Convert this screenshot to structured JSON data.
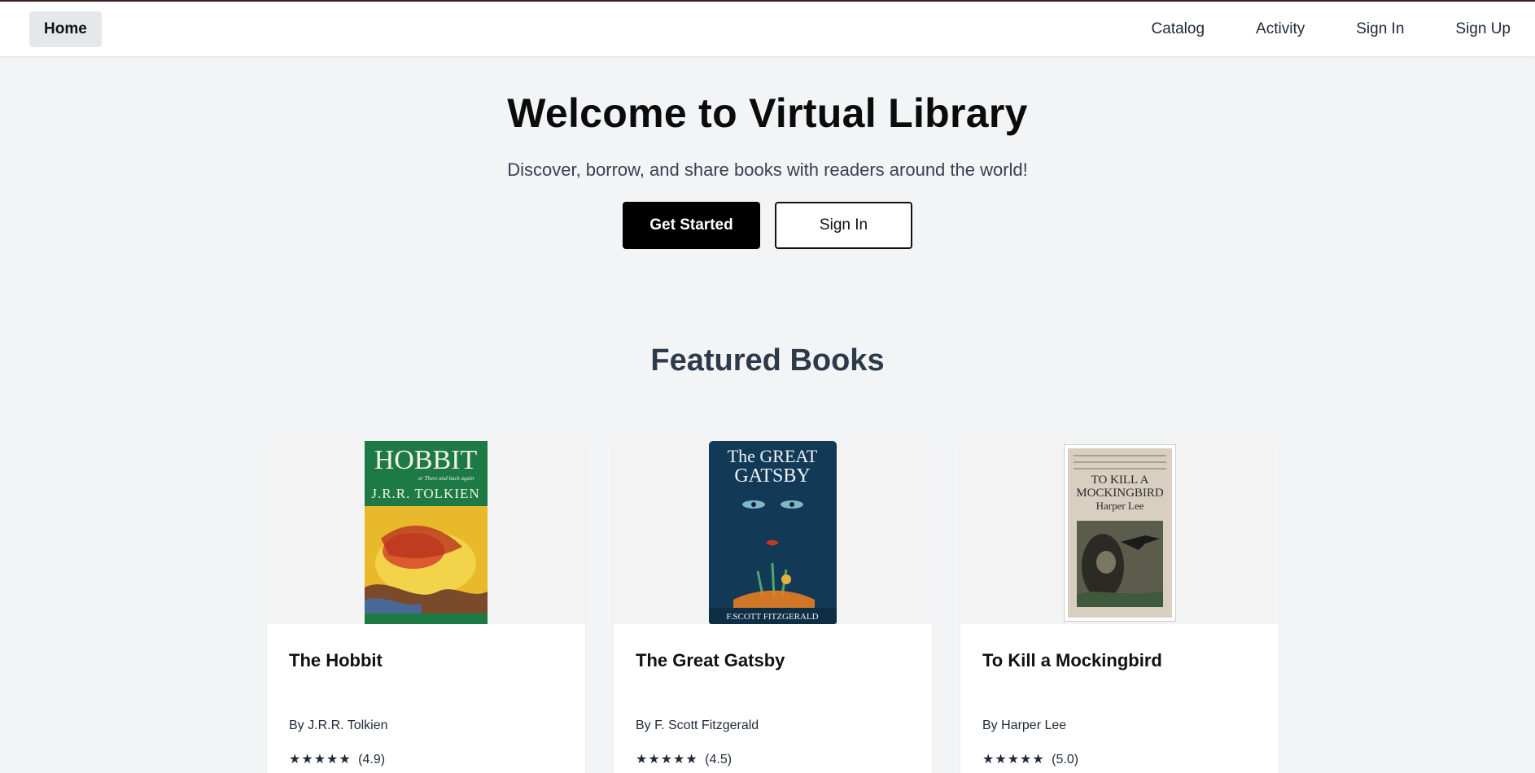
{
  "nav": {
    "home": "Home",
    "links": [
      "Catalog",
      "Activity",
      "Sign In",
      "Sign Up"
    ]
  },
  "hero": {
    "title": "Welcome to Virtual Library",
    "subtitle": "Discover, borrow, and share books with readers around the world!",
    "primary_button": "Get Started",
    "secondary_button": "Sign In"
  },
  "featured": {
    "title": "Featured Books",
    "books": [
      {
        "title": "The Hobbit",
        "author": "By J.R.R. Tolkien",
        "stars": "★★★★★",
        "rating": "(4.9)",
        "cover": {
          "title_line1": "HOBBIT",
          "title_line2": "or There and back again",
          "author": "J.R.R. TOLKIEN",
          "bg": "#1e7a45"
        }
      },
      {
        "title": "The Great Gatsby",
        "author": "By F. Scott Fitzgerald",
        "stars": "★★★★★",
        "rating": "(4.5)",
        "cover": {
          "title_line1": "The GREAT",
          "title_line2": "GATSBY",
          "author": "F.SCOTT FITZGERALD",
          "bg": "#123a57"
        }
      },
      {
        "title": "To Kill a Mockingbird",
        "author": "By Harper Lee",
        "stars": "★★★★★",
        "rating": "(5.0)",
        "cover": {
          "title_line1": "TO KILL A",
          "title_line2": "MOCKINGBIRD",
          "author": "Harper Lee",
          "bg": "#d9cfc0"
        }
      }
    ]
  }
}
